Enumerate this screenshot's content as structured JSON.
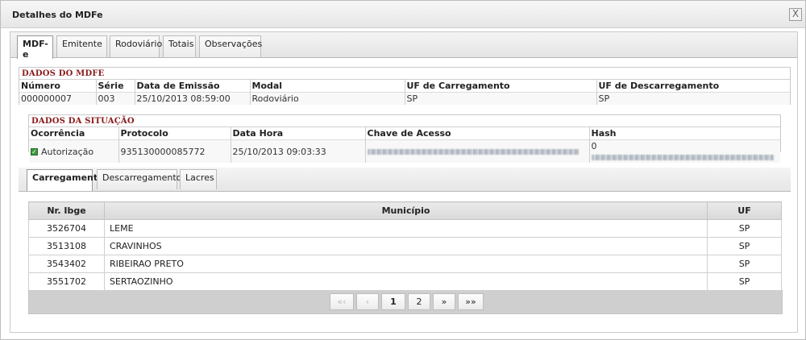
{
  "window": {
    "title": "Detalhes do MDFe",
    "close_label": "X"
  },
  "tabs": [
    "MDF-e",
    "Emitente",
    "Rodoviário",
    "Totais",
    "Observações"
  ],
  "dados_mdfe": {
    "section_title": "DADOS DO MDFE",
    "headers": [
      "Número",
      "Série",
      "Data de Emissão",
      "Modal",
      "UF de Carregamento",
      "UF de Descarregamento"
    ],
    "values": [
      "000000007",
      "003",
      "25/10/2013 08:59:00",
      "Rodoviário",
      "SP",
      "SP"
    ]
  },
  "dados_situacao": {
    "section_title": "DADOS DA SITUAÇÃO",
    "headers": [
      "Ocorrência",
      "Protocolo",
      "Data Hora",
      "Chave de Acesso",
      "Hash"
    ],
    "ocorrencia": "Autorização",
    "protocolo": "935130000085772",
    "data_hora": "25/10/2013 09:03:33",
    "hash_prefix": "0"
  },
  "subtabs": [
    "Carregamento",
    "Descarregamento",
    "Lacres"
  ],
  "grid": {
    "columns": [
      "Nr. Ibge",
      "Município",
      "UF"
    ],
    "rows": [
      [
        "3526704",
        "LEME",
        "SP"
      ],
      [
        "3513108",
        "CRAVINHOS",
        "SP"
      ],
      [
        "3543402",
        "RIBEIRAO PRETO",
        "SP"
      ],
      [
        "3551702",
        "SERTAOZINHO",
        "SP"
      ]
    ]
  },
  "pager": {
    "first": "«‹",
    "prev": "‹",
    "page1": "1",
    "page2": "2",
    "next": "»",
    "last": "»»"
  }
}
